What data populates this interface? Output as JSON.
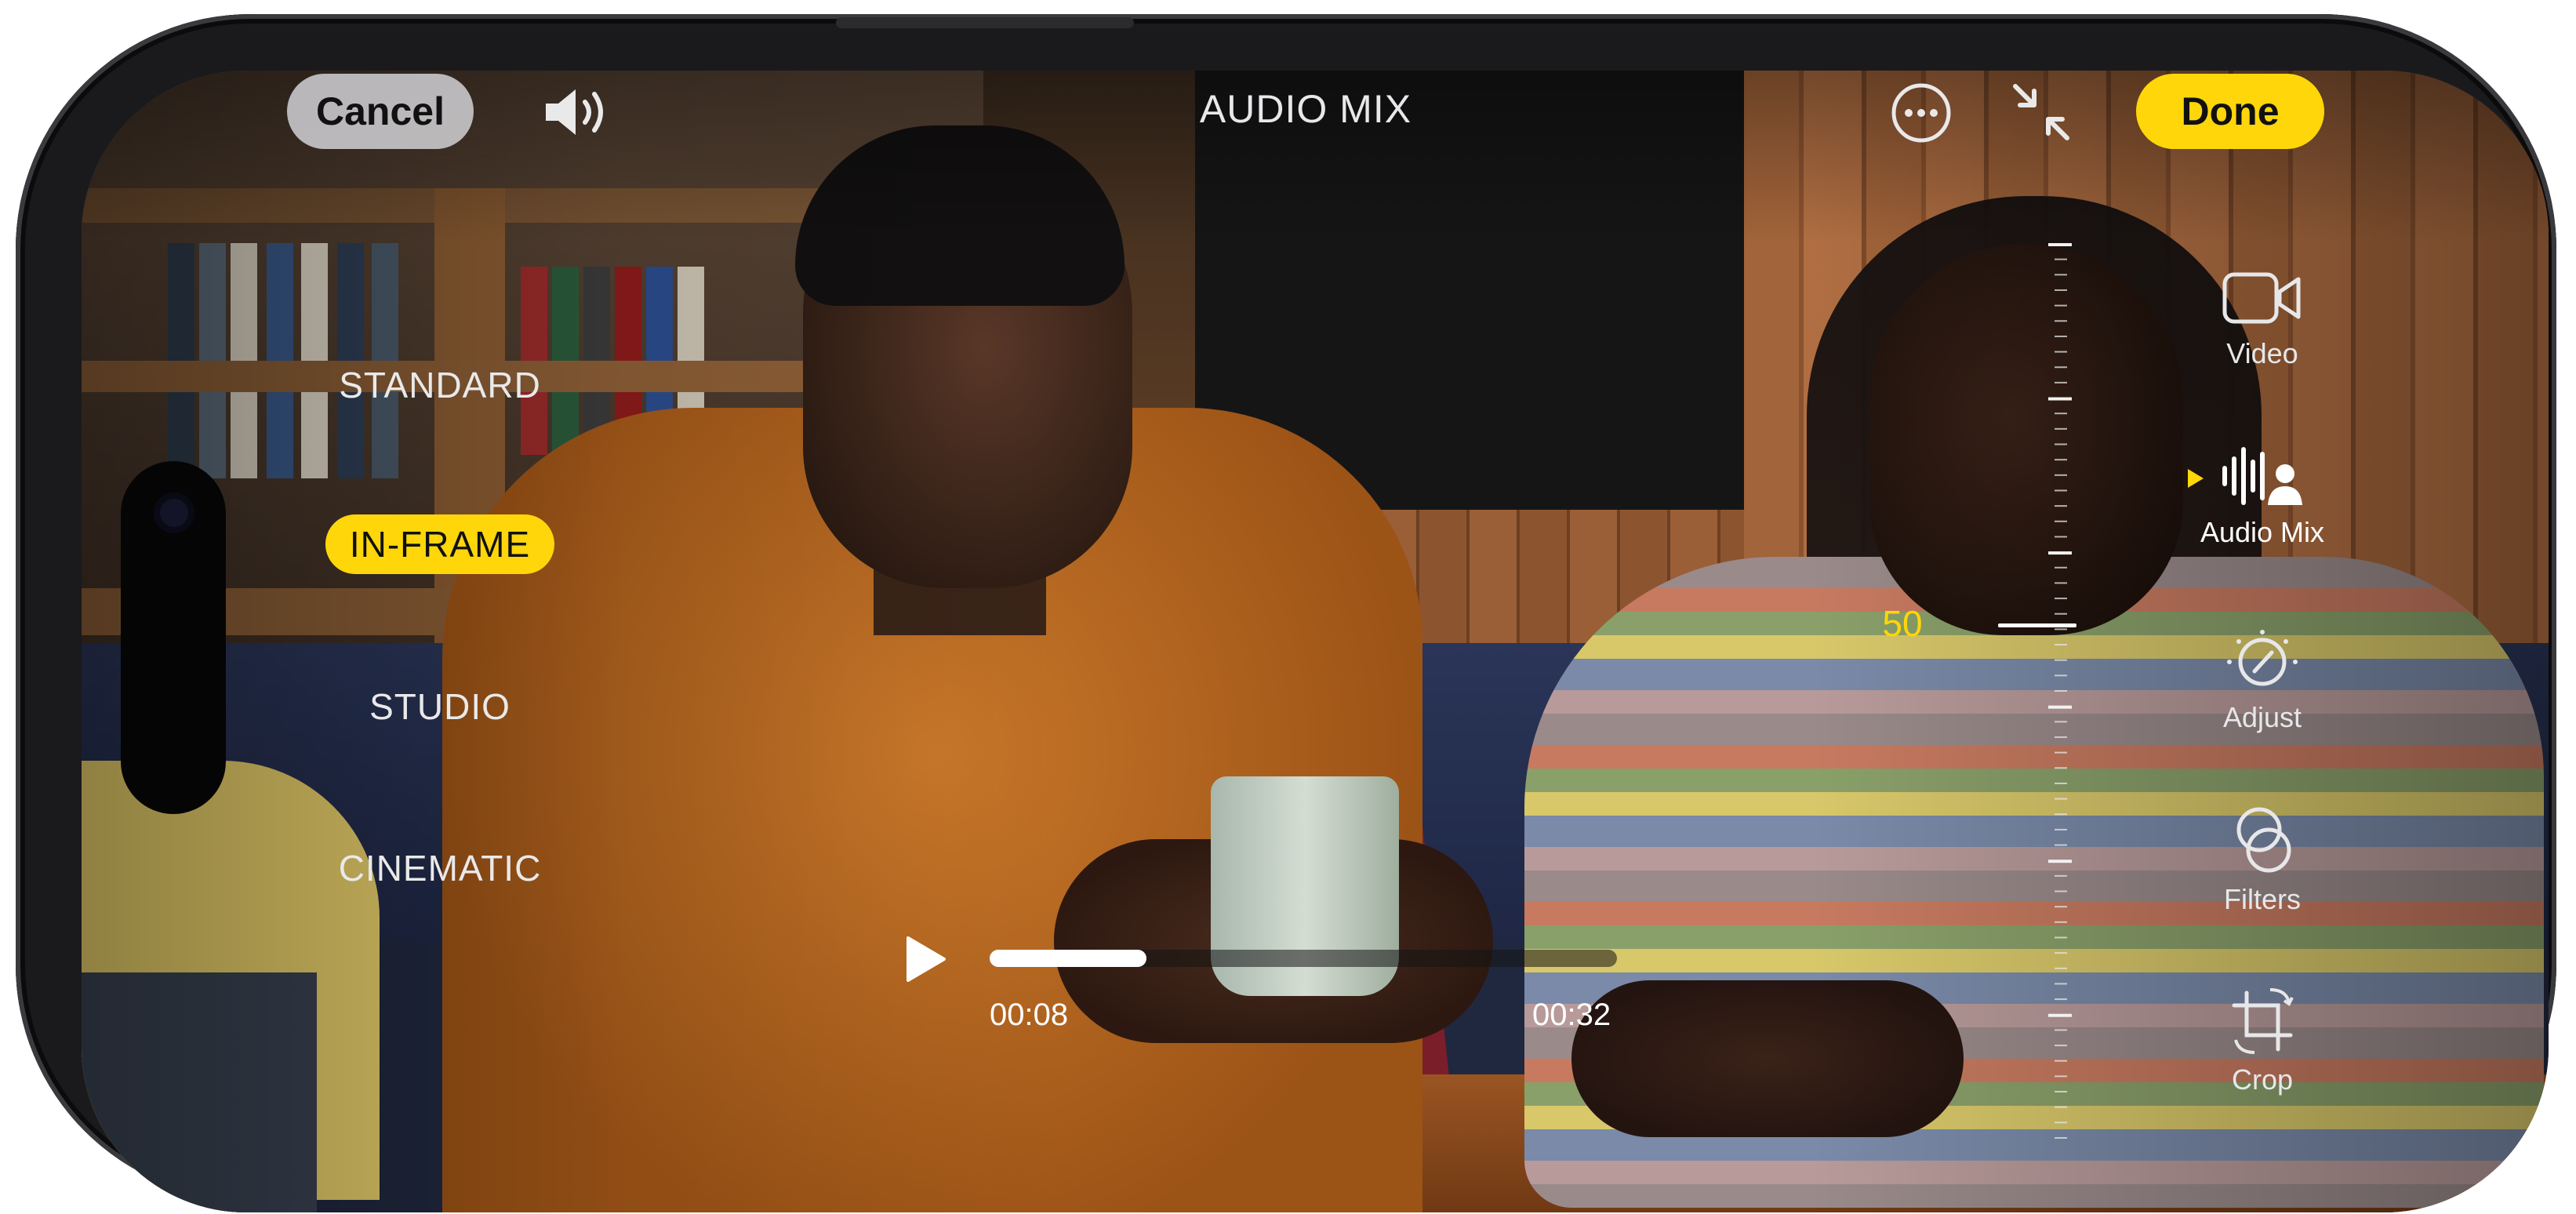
{
  "header": {
    "cancel_label": "Cancel",
    "title": "AUDIO MIX",
    "done_label": "Done"
  },
  "audio_modes": {
    "items": [
      "STANDARD",
      "IN-FRAME",
      "STUDIO",
      "CINEMATIC"
    ],
    "selected": "IN-FRAME"
  },
  "intensity_dial": {
    "value": "50",
    "fraction": 0.5
  },
  "toolbar": {
    "items": [
      {
        "label": "Video",
        "icon": "video-camera-icon",
        "active": false
      },
      {
        "label": "Audio Mix",
        "icon": "audio-mix-icon",
        "active": true
      },
      {
        "label": "Adjust",
        "icon": "adjust-dial-icon",
        "active": false
      },
      {
        "label": "Filters",
        "icon": "filters-icon",
        "active": false
      },
      {
        "label": "Crop",
        "icon": "crop-rotate-icon",
        "active": false
      }
    ]
  },
  "playback": {
    "current_time": "00:08",
    "duration": "00:32",
    "progress": 0.25
  },
  "colors": {
    "accent": "#ffd60a"
  }
}
